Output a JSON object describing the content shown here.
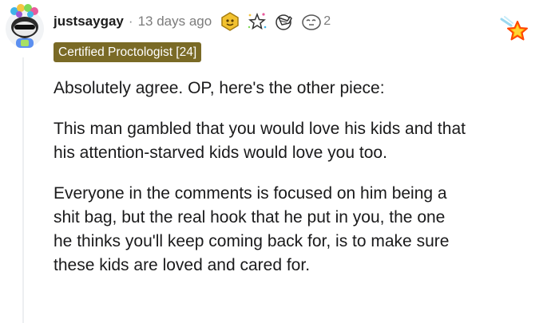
{
  "comment": {
    "author": "justsaygay",
    "separator": "·",
    "timestamp": "13 days ago",
    "award_count": "2",
    "flair": "Certified Proctologist [24]",
    "paragraphs": [
      {
        "lines": [
          "Absolutely agree. OP, here's the other piece:"
        ]
      },
      {
        "lines": [
          "This man gambled that you would love his kids and that",
          "his attention-starved kids would love you too."
        ]
      },
      {
        "lines": [
          "Everyone in the comments is focused on him being a",
          "shit bag, but the real hook that he put in you, the one",
          "he thinks you'll keep coming back for, is to make sure",
          "these kids are loved and cared for."
        ]
      }
    ]
  },
  "icons": {
    "avatar": "snoo-avatar-with-party-hat",
    "award_1": "gold-badge-icon",
    "award_2": "sparkle-star-icon",
    "award_3": "facepalm-icon",
    "award_4": "thinking-face-icon",
    "corner": "shooting-star-icon"
  },
  "colors": {
    "flair_bg": "#7a6a26",
    "flair_text": "#ffffff",
    "meta_text": "#7c7c7c",
    "body_text": "#1a1a1b"
  }
}
